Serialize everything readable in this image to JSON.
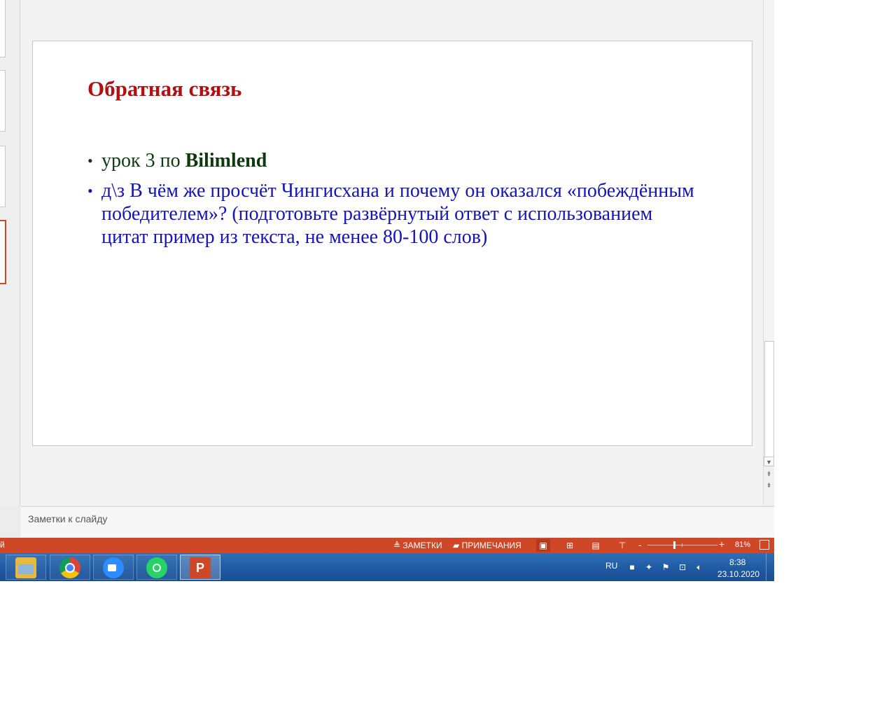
{
  "slide": {
    "title": "Обратная связь",
    "bullets": [
      {
        "text_prefix": "урок 3 по ",
        "text_bold": "Bilimlend"
      },
      {
        "text": "д\\з В чём же просчёт Чингисхана и почему он оказался «побеждённым победителем»? (подготовьте развёрнутый ответ с использованием цитат пример из текста, не менее 80-100 слов)"
      }
    ],
    "bullet_char": "•"
  },
  "notes": {
    "placeholder": "Заметки к слайду"
  },
  "statusbar": {
    "left_fragment": "й",
    "notes_label": "ЗАМЕТКИ",
    "comments_label": "ПРИМЕЧАНИЯ",
    "zoom_level": "81%",
    "zoom_minus": "-",
    "zoom_plus": "+",
    "active_view": "normal",
    "accent_color": "#d04727"
  },
  "taskbar": {
    "apps": [
      {
        "name": "file-explorer",
        "icon": "folder-icon"
      },
      {
        "name": "chrome",
        "icon": "chrome-icon"
      },
      {
        "name": "zoom",
        "icon": "zoom-icon"
      },
      {
        "name": "whatsapp",
        "icon": "whatsapp-icon"
      },
      {
        "name": "powerpoint",
        "icon": "powerpoint-icon",
        "glyph": "P",
        "open": true
      }
    ],
    "language": "RU",
    "time": "8:38",
    "date": "23.10.2020"
  },
  "colors": {
    "title": "#b21010",
    "bullet1": "#0c3a0c",
    "bullet2": "#1414b8"
  }
}
